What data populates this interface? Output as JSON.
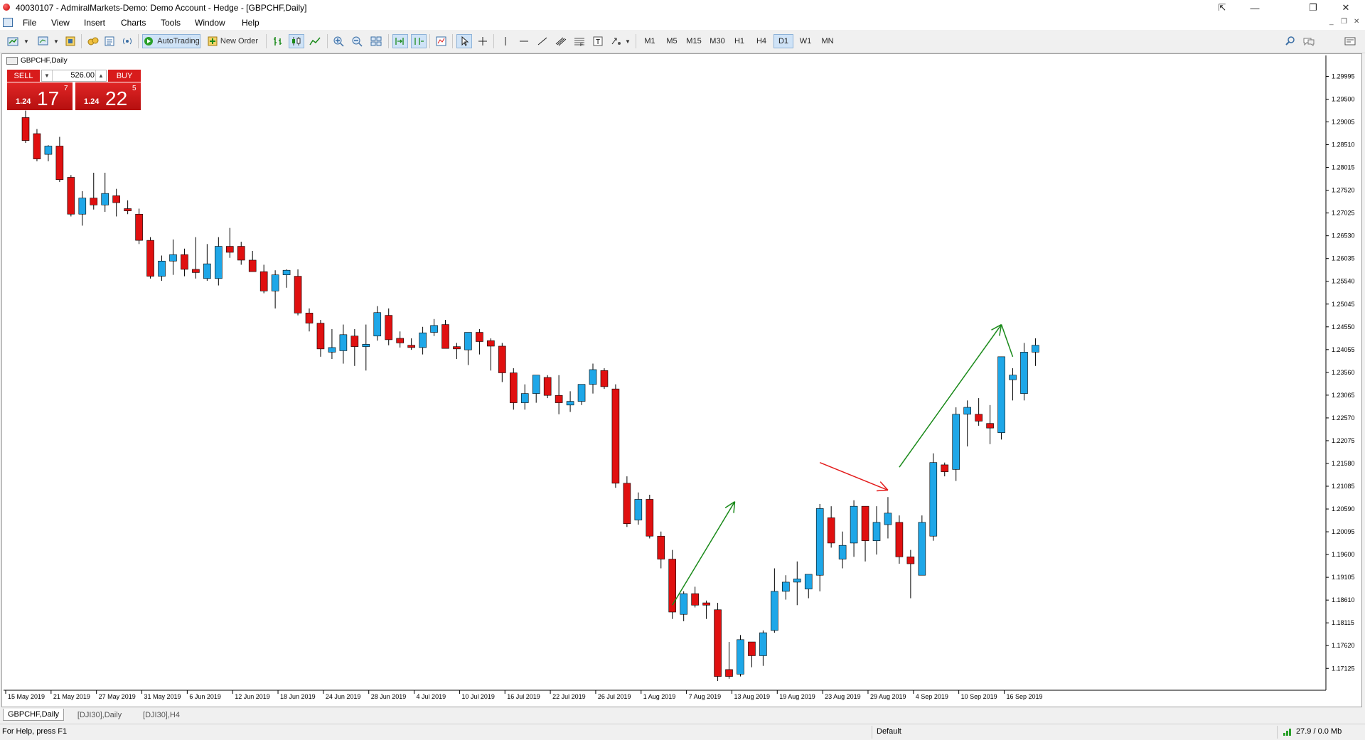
{
  "window": {
    "title": "40030107 - AdmiralMarkets-Demo: Demo Account - Hedge - [GBPCHF,Daily]",
    "controls": [
      "⇱",
      "—",
      "❐",
      "✕"
    ]
  },
  "menu": {
    "items": [
      "File",
      "View",
      "Insert",
      "Charts",
      "Tools",
      "Window",
      "Help"
    ],
    "mdi_controls": [
      "_",
      "❐",
      "✕"
    ]
  },
  "toolbar": {
    "autotrading_label": "AutoTrading",
    "new_order_label": "New Order",
    "timeframes": [
      "M1",
      "M5",
      "M15",
      "M30",
      "H1",
      "H4",
      "D1",
      "W1",
      "MN"
    ],
    "active_timeframe": "D1"
  },
  "chart": {
    "title": "GBPCHF,Daily",
    "one_click": {
      "sell_label": "SELL",
      "buy_label": "BUY",
      "lot": "526.00",
      "sell_price": {
        "pre": "1.24",
        "big": "17",
        "sup": "7"
      },
      "buy_price": {
        "pre": "1.24",
        "big": "22",
        "sup": "5"
      }
    },
    "colors": {
      "bull": "#1ea7e8",
      "bear": "#e01010",
      "wick": "#000000",
      "arrow_green": "#1a8a1a",
      "arrow_red": "#e31b1b"
    }
  },
  "chart_data": {
    "type": "candlestick",
    "symbol": "GBPCHF",
    "timeframe": "Daily",
    "ylim": [
      1.1665,
      1.3045
    ],
    "y_ticks": [
      "1.29995",
      "1.29500",
      "1.29005",
      "1.28510",
      "1.28015",
      "1.27520",
      "1.27025",
      "1.26530",
      "1.26035",
      "1.25540",
      "1.25045",
      "1.24550",
      "1.24055",
      "1.23560",
      "1.23065",
      "1.22570",
      "1.22075",
      "1.21580",
      "1.21085",
      "1.20590",
      "1.20095",
      "1.19600",
      "1.19105",
      "1.18610",
      "1.18115",
      "1.17620",
      "1.17125"
    ],
    "x_ticks": [
      "15 May 2019",
      "21 May 2019",
      "27 May 2019",
      "31 May 2019",
      "6 Jun 2019",
      "12 Jun 2019",
      "18 Jun 2019",
      "24 Jun 2019",
      "28 Jun 2019",
      "4 Jul 2019",
      "10 Jul 2019",
      "16 Jul 2019",
      "22 Jul 2019",
      "26 Jul 2019",
      "1 Aug 2019",
      "7 Aug 2019",
      "13 Aug 2019",
      "19 Aug 2019",
      "23 Aug 2019",
      "29 Aug 2019",
      "4 Sep 2019",
      "10 Sep 2019",
      "16 Sep 2019"
    ],
    "candles": [
      [
        1.291,
        1.2925,
        1.2855,
        1.286
      ],
      [
        1.2875,
        1.2885,
        1.2815,
        1.282
      ],
      [
        1.283,
        1.285,
        1.2815,
        1.2848
      ],
      [
        1.2848,
        1.2868,
        1.277,
        1.2775
      ],
      [
        1.278,
        1.2785,
        1.2695,
        1.27
      ],
      [
        1.27,
        1.275,
        1.2675,
        1.2735
      ],
      [
        1.2735,
        1.279,
        1.271,
        1.272
      ],
      [
        1.272,
        1.279,
        1.2705,
        1.2745
      ],
      [
        1.274,
        1.2755,
        1.2695,
        1.2725
      ],
      [
        1.2712,
        1.273,
        1.27,
        1.2707
      ],
      [
        1.27,
        1.2712,
        1.2635,
        1.2643
      ],
      [
        1.2643,
        1.265,
        1.256,
        1.2565
      ],
      [
        1.2565,
        1.261,
        1.2555,
        1.2598
      ],
      [
        1.2598,
        1.2645,
        1.2568,
        1.2612
      ],
      [
        1.2612,
        1.2625,
        1.2565,
        1.258
      ],
      [
        1.258,
        1.265,
        1.256,
        1.2573
      ],
      [
        1.256,
        1.2635,
        1.2555,
        1.2592
      ],
      [
        1.256,
        1.265,
        1.2545,
        1.263
      ],
      [
        1.263,
        1.267,
        1.2605,
        1.2617
      ],
      [
        1.263,
        1.264,
        1.259,
        1.26
      ],
      [
        1.26,
        1.262,
        1.2575,
        1.2575
      ],
      [
        1.2575,
        1.259,
        1.2528,
        1.2533
      ],
      [
        1.2533,
        1.2578,
        1.2495,
        1.2568
      ],
      [
        1.2568,
        1.258,
        1.254,
        1.2578
      ],
      [
        1.2565,
        1.258,
        1.248,
        1.2485
      ],
      [
        1.2485,
        1.2495,
        1.2445,
        1.2463
      ],
      [
        1.2463,
        1.247,
        1.239,
        1.2407
      ],
      [
        1.24,
        1.245,
        1.2385,
        1.241
      ],
      [
        1.2403,
        1.246,
        1.2375,
        1.2438
      ],
      [
        1.2435,
        1.245,
        1.237,
        1.2412
      ],
      [
        1.2412,
        1.246,
        1.236,
        1.2417
      ],
      [
        1.2435,
        1.25,
        1.2425,
        1.2486
      ],
      [
        1.248,
        1.2495,
        1.2415,
        1.2427
      ],
      [
        1.243,
        1.2445,
        1.241,
        1.242
      ],
      [
        1.2415,
        1.243,
        1.2405,
        1.241
      ],
      [
        1.241,
        1.2455,
        1.2395,
        1.2442
      ],
      [
        1.2443,
        1.2472,
        1.2435,
        1.2458
      ],
      [
        1.246,
        1.247,
        1.2408,
        1.2408
      ],
      [
        1.2412,
        1.242,
        1.2385,
        1.2407
      ],
      [
        1.2405,
        1.2435,
        1.2372,
        1.2443
      ],
      [
        1.2443,
        1.245,
        1.2395,
        1.2423
      ],
      [
        1.2425,
        1.243,
        1.236,
        1.2413
      ],
      [
        1.2413,
        1.242,
        1.2335,
        1.2355
      ],
      [
        1.2355,
        1.2365,
        1.2275,
        1.229
      ],
      [
        1.229,
        1.233,
        1.2275,
        1.231
      ],
      [
        1.231,
        1.2345,
        1.229,
        1.235
      ],
      [
        1.2345,
        1.235,
        1.23,
        1.2306
      ],
      [
        1.2306,
        1.235,
        1.2265,
        1.229
      ],
      [
        1.2285,
        1.2315,
        1.227,
        1.2293
      ],
      [
        1.2293,
        1.2325,
        1.2285,
        1.233
      ],
      [
        1.233,
        1.2375,
        1.231,
        1.2362
      ],
      [
        1.236,
        1.2365,
        1.232,
        1.2325
      ],
      [
        1.232,
        1.233,
        1.2105,
        1.2115
      ],
      [
        1.2115,
        1.213,
        1.202,
        1.2027
      ],
      [
        1.2035,
        1.2095,
        1.2025,
        1.208
      ],
      [
        1.208,
        1.209,
        1.1995,
        1.2
      ],
      [
        1.2,
        1.201,
        1.193,
        1.195
      ],
      [
        1.195,
        1.197,
        1.182,
        1.1835
      ],
      [
        1.183,
        1.188,
        1.1815,
        1.1875
      ],
      [
        1.1875,
        1.189,
        1.1845,
        1.185
      ],
      [
        1.1855,
        1.186,
        1.182,
        1.185
      ],
      [
        1.184,
        1.1855,
        1.1685,
        1.1695
      ],
      [
        1.171,
        1.177,
        1.169,
        1.1695
      ],
      [
        1.17,
        1.1785,
        1.1695,
        1.1775
      ],
      [
        1.177,
        1.177,
        1.1715,
        1.174
      ],
      [
        1.174,
        1.1795,
        1.1718,
        1.179
      ],
      [
        1.1795,
        1.193,
        1.179,
        1.188
      ],
      [
        1.188,
        1.1915,
        1.1862,
        1.19
      ],
      [
        1.19,
        1.1945,
        1.185,
        1.1907
      ],
      [
        1.1885,
        1.1905,
        1.1865,
        1.1917
      ],
      [
        1.1915,
        1.207,
        1.188,
        1.206
      ],
      [
        1.204,
        1.2065,
        1.1975,
        1.1985
      ],
      [
        1.195,
        1.201,
        1.193,
        1.198
      ],
      [
        1.1985,
        1.2078,
        1.1955,
        1.2065
      ],
      [
        1.2065,
        1.2065,
        1.1945,
        1.199
      ],
      [
        1.199,
        1.2065,
        1.196,
        1.203
      ],
      [
        1.2025,
        1.2085,
        1.1995,
        1.205
      ],
      [
        1.203,
        1.2045,
        1.194,
        1.1955
      ],
      [
        1.1955,
        1.197,
        1.1865,
        1.194
      ],
      [
        1.1915,
        1.2045,
        1.1915,
        1.203
      ],
      [
        1.2,
        1.218,
        1.199,
        1.216
      ],
      [
        1.2155,
        1.216,
        1.213,
        1.214
      ],
      [
        1.2145,
        1.228,
        1.212,
        1.2265
      ],
      [
        1.2265,
        1.2295,
        1.2195,
        1.228
      ],
      [
        1.2265,
        1.23,
        1.224,
        1.225
      ],
      [
        1.2245,
        1.2285,
        1.22,
        1.2235
      ],
      [
        1.2225,
        1.239,
        1.221,
        1.239
      ],
      [
        1.234,
        1.2365,
        1.2295,
        1.235
      ],
      [
        1.231,
        1.242,
        1.2295,
        1.24
      ],
      [
        1.24,
        1.243,
        1.237,
        1.2415
      ]
    ],
    "annotations": [
      {
        "kind": "arrow",
        "color": "green",
        "from": [
          57.0,
          1.185
        ],
        "to": [
          62.5,
          1.2075
        ]
      },
      {
        "kind": "arrow",
        "color": "red",
        "from": [
          70.0,
          1.216
        ],
        "to": [
          76.0,
          1.21
        ]
      },
      {
        "kind": "arrow",
        "color": "green",
        "from": [
          77.0,
          1.215
        ],
        "to": [
          86.0,
          1.246
        ]
      },
      {
        "kind": "line",
        "color": "green",
        "from": [
          86.0,
          1.246
        ],
        "to": [
          87.0,
          1.239
        ]
      }
    ]
  },
  "tabs": [
    "GBPCHF,Daily",
    "[DJI30],Daily",
    "[DJI30],H4"
  ],
  "status": {
    "help": "For Help, press F1",
    "profile": "Default",
    "connection": "27.9 / 0.0 Mb"
  }
}
